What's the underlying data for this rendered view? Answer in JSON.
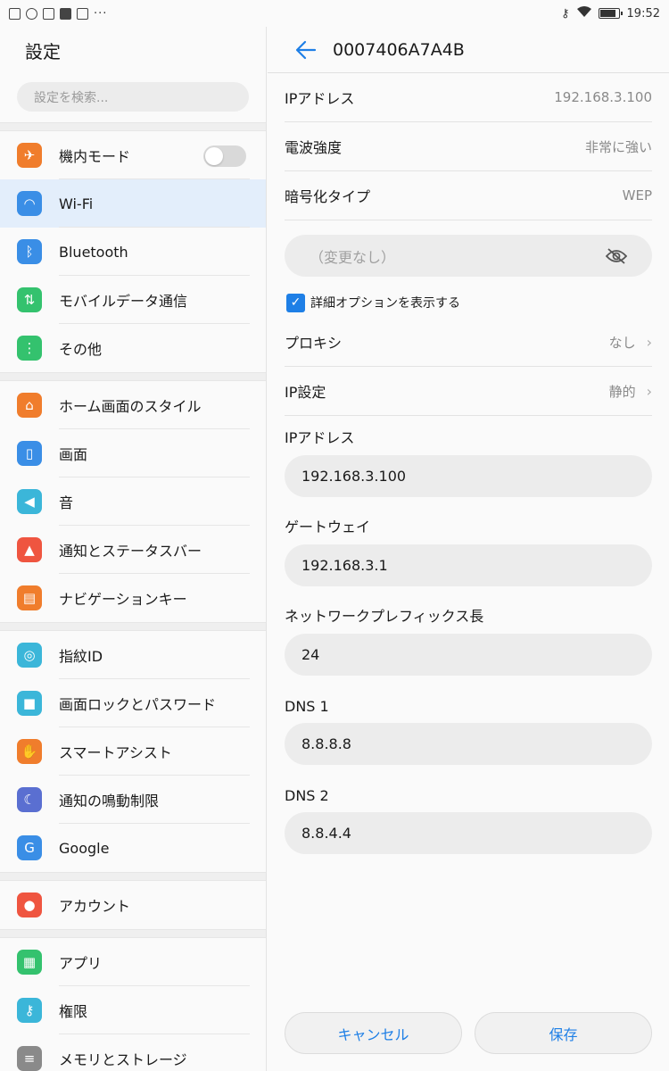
{
  "status_bar": {
    "time": "19:52",
    "more": "···"
  },
  "left": {
    "title": "設定",
    "search_placeholder": "設定を検索...",
    "groups": [
      [
        {
          "label": "機内モード",
          "icon": "airplane-icon",
          "color": "#f07d2c",
          "toggle": "off"
        },
        {
          "label": "Wi-Fi",
          "icon": "wifi-icon",
          "color": "#3a8ee6",
          "selected": true
        },
        {
          "label": "Bluetooth",
          "icon": "bluetooth-icon",
          "color": "#3a8ee6"
        },
        {
          "label": "モバイルデータ通信",
          "icon": "mobile-data-icon",
          "color": "#34c26e"
        },
        {
          "label": "その他",
          "icon": "more-icon",
          "color": "#34c26e"
        }
      ],
      [
        {
          "label": "ホーム画面のスタイル",
          "icon": "home-icon",
          "color": "#f07d2c"
        },
        {
          "label": "画面",
          "icon": "display-icon",
          "color": "#3a8ee6"
        },
        {
          "label": "音",
          "icon": "sound-icon",
          "color": "#3bb6d9"
        },
        {
          "label": "通知とステータスバー",
          "icon": "notification-icon",
          "color": "#ef5540"
        },
        {
          "label": "ナビゲーションキー",
          "icon": "navigation-key-icon",
          "color": "#f07d2c"
        }
      ],
      [
        {
          "label": "指紋ID",
          "icon": "fingerprint-icon",
          "color": "#3bb6d9"
        },
        {
          "label": "画面ロックとパスワード",
          "icon": "lock-icon",
          "color": "#3bb6d9"
        },
        {
          "label": "スマートアシスト",
          "icon": "hand-icon",
          "color": "#f07d2c"
        },
        {
          "label": "通知の鳴動制限",
          "icon": "moon-icon",
          "color": "#5a6fd1"
        },
        {
          "label": "Google",
          "icon": "google-icon",
          "color": "#3a8ee6"
        }
      ],
      [
        {
          "label": "アカウント",
          "icon": "account-icon",
          "color": "#ef5540"
        }
      ],
      [
        {
          "label": "アプリ",
          "icon": "apps-icon",
          "color": "#34c26e"
        },
        {
          "label": "権限",
          "icon": "key-icon",
          "color": "#3bb6d9"
        },
        {
          "label": "メモリとストレージ",
          "icon": "storage-icon",
          "color": "#8a8a8a"
        }
      ]
    ]
  },
  "right": {
    "title": "0007406A7A4B",
    "info": [
      {
        "label": "IPアドレス",
        "value": "192.168.3.100"
      },
      {
        "label": "電波強度",
        "value": "非常に強い"
      },
      {
        "label": "暗号化タイプ",
        "value": "WEP"
      }
    ],
    "password_placeholder": "（変更なし）",
    "show_advanced_label": "詳細オプションを表示する",
    "proxy": {
      "label": "プロキシ",
      "value": "なし"
    },
    "ip_settings": {
      "label": "IP設定",
      "value": "静的"
    },
    "fields": [
      {
        "label": "IPアドレス",
        "value": "192.168.3.100"
      },
      {
        "label": "ゲートウェイ",
        "value": "192.168.3.1"
      },
      {
        "label": "ネットワークプレフィックス長",
        "value": "24"
      },
      {
        "label": "DNS 1",
        "value": "8.8.8.8"
      },
      {
        "label": "DNS 2",
        "value": "8.8.4.4"
      }
    ],
    "cancel_label": "キャンセル",
    "save_label": "保存"
  }
}
